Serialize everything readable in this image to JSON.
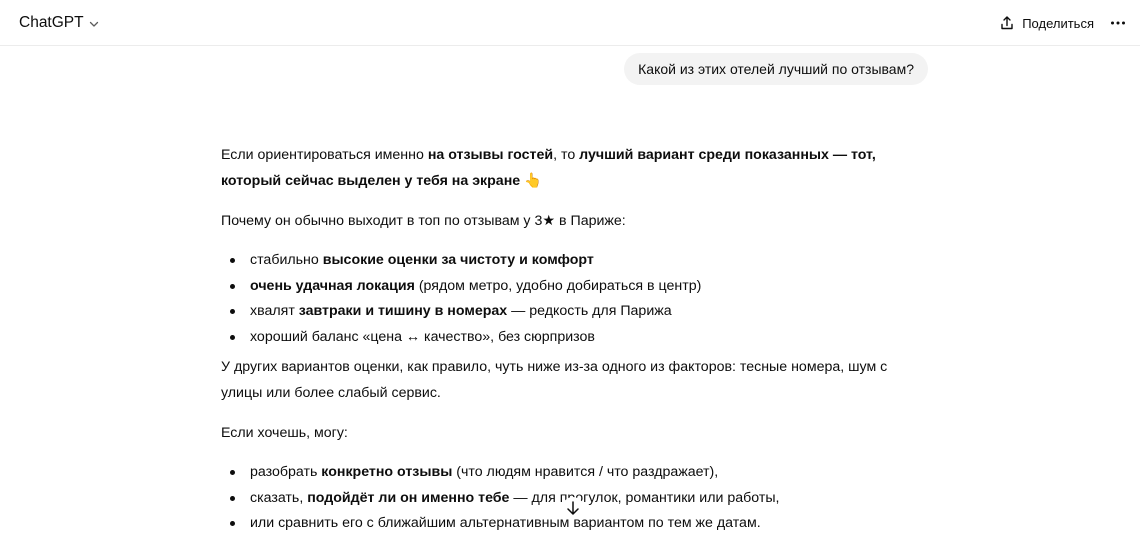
{
  "header": {
    "model_name": "ChatGPT",
    "share_label": "Поделиться",
    "icons": {
      "model_menu": "chevron-down-icon",
      "share": "share-icon",
      "more": "more-options-icon"
    }
  },
  "user_message": "Какой из этих отелей лучший по отзывам?",
  "answer": {
    "p1": {
      "t1": "Если ориентироваться именно ",
      "b1": "на отзывы гостей",
      "t2": ", то ",
      "b2": "лучший вариант среди показанных — тот, который сейчас выделен у тебя на экране",
      "emoji": "👆"
    },
    "p2": "Почему он обычно выходит в топ по отзывам у 3★ в Париже:",
    "list1": [
      {
        "pre": "стабильно ",
        "bold": "высокие оценки за чистоту и комфорт",
        "post": ""
      },
      {
        "pre": "",
        "bold": "очень удачная локация",
        "post": " (рядом метро, удобно добираться в центр)"
      },
      {
        "pre": "хвалят ",
        "bold": "завтраки и тишину в номерах",
        "post": " — редкость для Парижа"
      },
      {
        "pre": "хороший баланс «цена ↔ качество», без сюрпризов",
        "bold": "",
        "post": ""
      }
    ],
    "p3": "У других вариантов оценки, как правило, чуть ниже из-за одного из факторов: тесные номера, шум с улицы или более слабый сервис.",
    "p4": "Если хочешь, могу:",
    "list2": [
      {
        "pre": "разобрать ",
        "bold": "конкретно отзывы",
        "post": " (что людям нравится / что раздражает),"
      },
      {
        "pre": "сказать, ",
        "bold": "подойдёт ли он именно тебе",
        "post": " — для прогулок, романтики или работы,"
      },
      {
        "pre": "или сравнить его с ближайшим альтернативным вариантом по тем же датам.",
        "bold": "",
        "post": ""
      }
    ]
  },
  "scroll_button_icon": "arrow-down-icon"
}
